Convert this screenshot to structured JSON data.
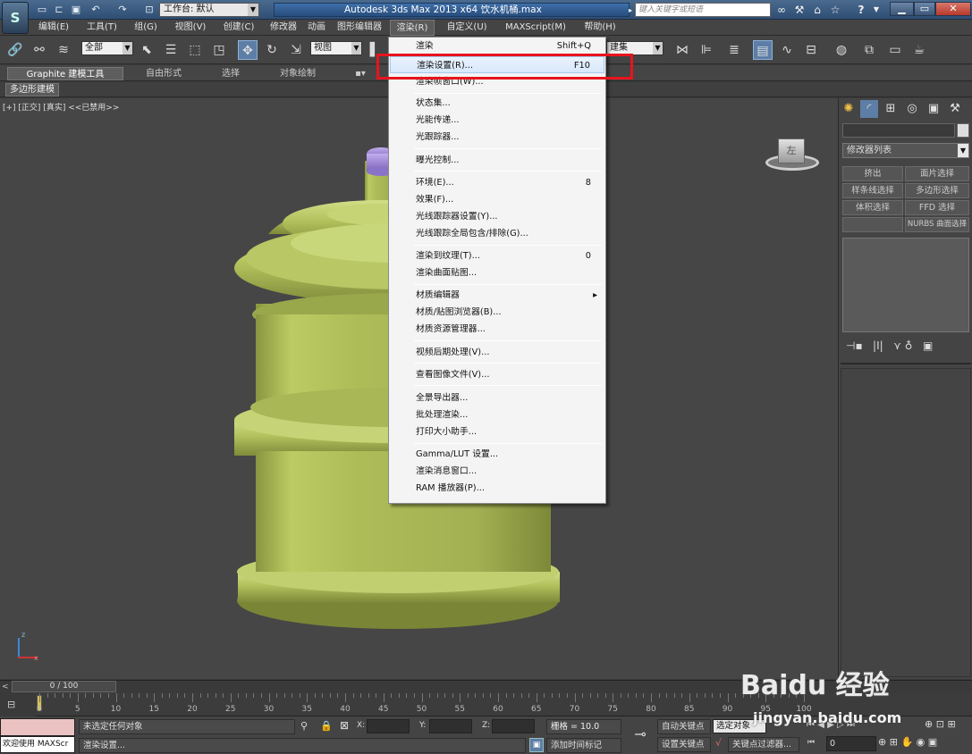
{
  "titlebar": {
    "app_logo": "S",
    "workspace": "工作台: 默认",
    "window_title": "Autodesk 3ds Max  2013 x64      饮水机桶.max",
    "search_placeholder": "键入关键字或短语",
    "help": "?"
  },
  "menubar": [
    "编辑(E)",
    "工具(T)",
    "组(G)",
    "视图(V)",
    "创建(C)",
    "修改器",
    "动画",
    "图形编辑器",
    "渲染(R)",
    "自定义(U)",
    "MAXScript(M)",
    "帮助(H)"
  ],
  "toolbar": {
    "selection_filter": "全部",
    "reference_coord": "视图",
    "named_selection": "建集"
  },
  "ribbon": {
    "tabs": [
      "Graphite 建模工具",
      "自由形式",
      "选择",
      "对象绘制"
    ],
    "sub_tab": "多边形建模"
  },
  "viewport": {
    "label": "[+] [正交] [真实]  <<已禁用>>",
    "viewcube_label": "左",
    "axis_z": "z",
    "axis_x": "x"
  },
  "render_menu": {
    "items": [
      {
        "label": "渲染",
        "shortcut": "Shift+Q"
      },
      {
        "label": "渲染设置(R)...",
        "shortcut": "F10"
      },
      {
        "label": "渲染帧窗口(W)...",
        "shortcut": ""
      },
      {
        "label": "状态集...",
        "shortcut": ""
      },
      {
        "label": "光能传递...",
        "shortcut": ""
      },
      {
        "label": "光跟踪器...",
        "shortcut": ""
      },
      {
        "label": "曝光控制...",
        "shortcut": ""
      },
      {
        "label": "环境(E)...",
        "shortcut": "8"
      },
      {
        "label": "效果(F)...",
        "shortcut": ""
      },
      {
        "label": "光线跟踪器设置(Y)...",
        "shortcut": ""
      },
      {
        "label": "光线跟踪全局包含/排除(G)...",
        "shortcut": ""
      },
      {
        "label": "渲染到纹理(T)...",
        "shortcut": "0"
      },
      {
        "label": "渲染曲面贴图...",
        "shortcut": ""
      },
      {
        "label": "材质编辑器",
        "shortcut": "▸"
      },
      {
        "label": "材质/贴图浏览器(B)...",
        "shortcut": ""
      },
      {
        "label": "材质资源管理器...",
        "shortcut": ""
      },
      {
        "label": "视频后期处理(V)...",
        "shortcut": ""
      },
      {
        "label": "查看图像文件(V)...",
        "shortcut": ""
      },
      {
        "label": "全景导出器...",
        "shortcut": ""
      },
      {
        "label": "批处理渲染...",
        "shortcut": ""
      },
      {
        "label": "打印大小助手...",
        "shortcut": ""
      },
      {
        "label": "Gamma/LUT 设置...",
        "shortcut": ""
      },
      {
        "label": "渲染消息窗口...",
        "shortcut": ""
      },
      {
        "label": "RAM 播放器(P)...",
        "shortcut": ""
      }
    ]
  },
  "command_panel": {
    "modifier_list": "修改器列表",
    "buttons": [
      "挤出",
      "面片选择",
      "样条线选择",
      "多边形选择",
      "体积选择",
      "FFD 选择",
      "",
      "NURBS 曲面选择"
    ]
  },
  "timeline": {
    "frame": "0 / 100",
    "ticks": [
      "0",
      "5",
      "10",
      "15",
      "20",
      "25",
      "30",
      "35",
      "40",
      "45",
      "50",
      "55",
      "60",
      "65",
      "70",
      "75",
      "80",
      "85",
      "90",
      "95",
      "100"
    ]
  },
  "statusbar": {
    "maxscript": "欢迎使用 MAXScr",
    "selection_status": "未选定任何对象",
    "prompt": "渲染设置...",
    "x_label": "X:",
    "y_label": "Y:",
    "z_label": "Z:",
    "grid": "栅格 = 10.0",
    "add_time_tag": "添加时间标记",
    "auto_key": "自动关键点",
    "set_key": "设置关键点",
    "selected_dropdown": "选定对象",
    "key_filters": "关键点过滤器...",
    "frame_field": "0"
  },
  "watermark": {
    "logo": "Bai​du 经验",
    "url": "jingyan.baidu.com"
  },
  "colors": {
    "bottle": "#b4c35c",
    "cap": "#9c82d0",
    "highlight": "#e8141c",
    "menu_hover": "#d8e8fb"
  }
}
